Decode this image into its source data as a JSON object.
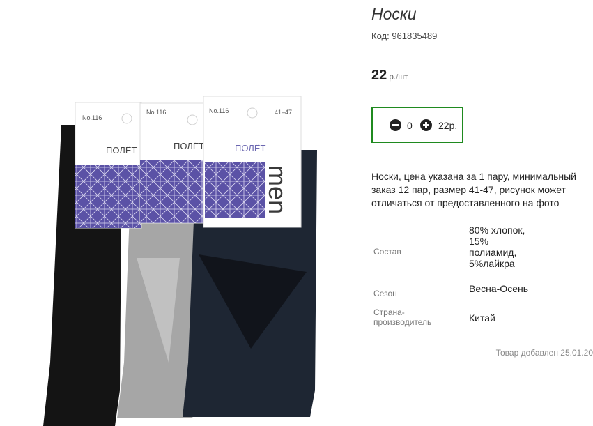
{
  "product": {
    "title": "Носки",
    "code_label": "Код: 961835489",
    "price_value": "22",
    "price_currency": "р.",
    "price_suffix": "/шт.",
    "description": "Носки, цена указана за 1 пару, минимальный заказ 12 пар, размер 41-47, рисунок может отличаться от предоставленного на фото",
    "added_label": "Товар добавлен 25.01.20"
  },
  "quantity": {
    "count": "0",
    "total": "22р.",
    "minus_icon": "minus-circle-icon",
    "plus_icon": "plus-circle-icon",
    "border_color": "#1f8a1f"
  },
  "specs": [
    {
      "label": "Состав",
      "value": "80% хлопок, 15% полиамид, 5%лайкра"
    },
    {
      "label": "Сезон",
      "value": "Весна-Осень"
    },
    {
      "label": "Страна-производитель",
      "value": "Китай"
    }
  ],
  "photo": {
    "card_number": "No.116",
    "card_size": "41–47",
    "brand": "ПОЛЁТ",
    "side_text": "men",
    "colors": [
      "#141414",
      "#a6a6a6",
      "#1e2633"
    ],
    "pattern_color": "#5b52a6"
  }
}
